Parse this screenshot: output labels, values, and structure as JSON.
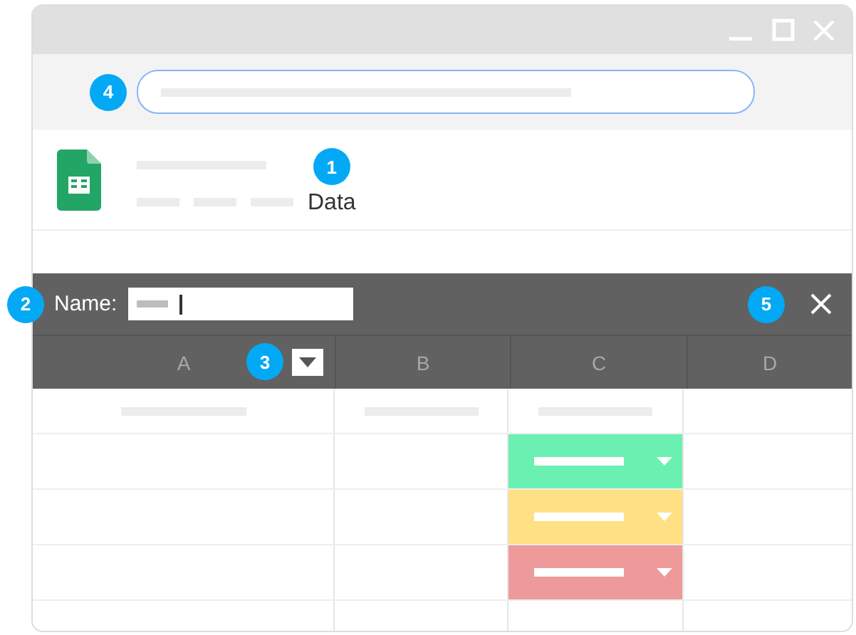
{
  "search_bar": {
    "badge": "4"
  },
  "file": {
    "badge": "1",
    "label": "Data"
  },
  "name_bar": {
    "badge": "2",
    "label": "Name:",
    "close_badge": "5"
  },
  "columns": [
    {
      "label": "A",
      "badge": "3"
    },
    {
      "label": "B"
    },
    {
      "label": "C"
    },
    {
      "label": "D"
    }
  ],
  "status_chips": [
    {
      "color": "#6af0b0"
    },
    {
      "color": "#ffe085"
    },
    {
      "color": "#ee9a9a"
    }
  ]
}
